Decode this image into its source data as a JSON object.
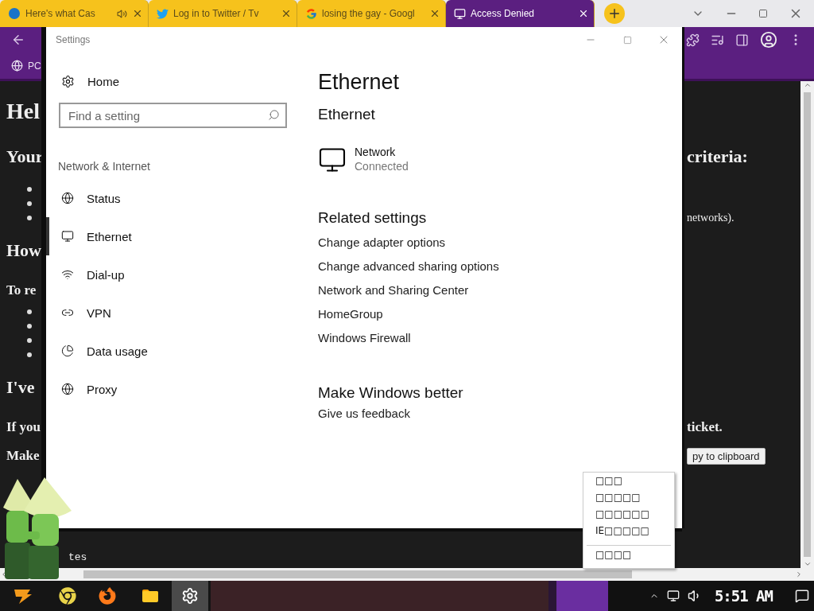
{
  "browser": {
    "tabs": [
      {
        "title": "Here's what Cas",
        "audio": true,
        "selected": false
      },
      {
        "title": "Log in to Twitter / Tv",
        "audio": false,
        "selected": false
      },
      {
        "title": "losing the gay - Googl",
        "audio": false,
        "selected": false
      },
      {
        "title": "Access Denied",
        "audio": false,
        "selected": true
      }
    ],
    "bookmark": "PC"
  },
  "page": {
    "rows": [
      {
        "kind": "title",
        "left": "Hel"
      },
      {
        "kind": "heading",
        "left": "Your",
        "right": "criteria:"
      },
      {
        "kind": "bullet"
      },
      {
        "kind": "bullet"
      },
      {
        "kind": "bullet",
        "right": "networks)."
      },
      {
        "kind": "heading",
        "left": "How"
      },
      {
        "kind": "strong",
        "left": "To re"
      },
      {
        "kind": "bullet"
      },
      {
        "kind": "bullet"
      },
      {
        "kind": "bullet"
      },
      {
        "kind": "bullet"
      },
      {
        "kind": "heading",
        "left": "I've"
      },
      {
        "kind": "strong",
        "left": "If you",
        "right": "ticket."
      },
      {
        "kind": "strong",
        "left": "Make",
        "button": "py to clipboard"
      },
      {
        "kind": "code",
        "left": "tes"
      }
    ]
  },
  "settings": {
    "title": "Settings",
    "home": "Home",
    "search": {
      "placeholder": "Find a setting"
    },
    "section": "Network & Internet",
    "nav": [
      {
        "label": "Status",
        "selected": false
      },
      {
        "label": "Ethernet",
        "selected": true
      },
      {
        "label": "Dial-up",
        "selected": false
      },
      {
        "label": "VPN",
        "selected": false
      },
      {
        "label": "Data usage",
        "selected": false
      },
      {
        "label": "Proxy",
        "selected": false
      }
    ],
    "heading": "Ethernet",
    "subheading": "Ethernet",
    "network": {
      "name": "Network",
      "status": "Connected"
    },
    "related_title": "Related settings",
    "related_links": [
      "Change adapter options",
      "Change advanced sharing options",
      "Network and Sharing Center",
      "HomeGroup",
      "Windows Firewall"
    ],
    "better_title": "Make Windows better",
    "feedback": "Give us feedback"
  },
  "context_menu": {
    "items": [
      {
        "label": "□□□"
      },
      {
        "label": "□□□□□"
      },
      {
        "label": "□□□□□□"
      },
      {
        "label": "IE□□□□□"
      },
      {
        "kind": "divider"
      },
      {
        "label": "□□□□"
      }
    ]
  },
  "taskbar": {
    "apps": [
      {
        "active": false
      },
      {
        "active": false
      },
      {
        "active": false
      },
      {
        "active": false
      },
      {
        "active": true
      }
    ],
    "time": "5:51 AM"
  }
}
